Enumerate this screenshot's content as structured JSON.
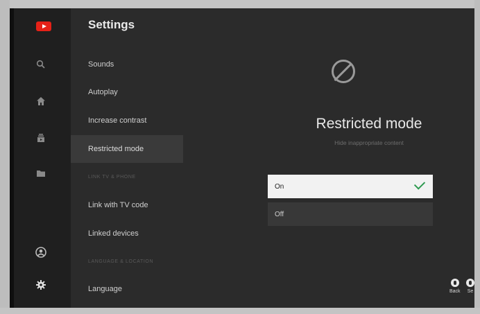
{
  "app": {
    "brand_color": "#e62117",
    "logo_icon": "youtube-logo"
  },
  "rail": {
    "items": [
      {
        "name": "search",
        "icon": "search-icon"
      },
      {
        "name": "home",
        "icon": "home-icon"
      },
      {
        "name": "subscriptions",
        "icon": "subscriptions-icon"
      },
      {
        "name": "library",
        "icon": "folder-icon"
      },
      {
        "name": "account",
        "icon": "account-icon"
      },
      {
        "name": "settings",
        "icon": "gear-icon",
        "active": true
      }
    ]
  },
  "settings": {
    "title": "Settings",
    "items": [
      {
        "label": "Sounds"
      },
      {
        "label": "Autoplay"
      },
      {
        "label": "Increase contrast"
      },
      {
        "label": "Restricted mode",
        "selected": true
      }
    ],
    "section_link": "LINK TV & PHONE",
    "link_items": [
      {
        "label": "Link with TV code"
      },
      {
        "label": "Linked devices"
      }
    ],
    "section_language": "LANGUAGE & LOCATION",
    "language_items": [
      {
        "label": "Language"
      }
    ]
  },
  "detail": {
    "icon": "block-icon",
    "title": "Restricted mode",
    "subtitle": "Hide inappropriate content",
    "options": [
      {
        "label": "On",
        "selected": true
      },
      {
        "label": "Off",
        "selected": false
      }
    ],
    "accent_color": "#2e9a50"
  },
  "hints": [
    {
      "label": "Back"
    },
    {
      "label": "Se"
    }
  ]
}
